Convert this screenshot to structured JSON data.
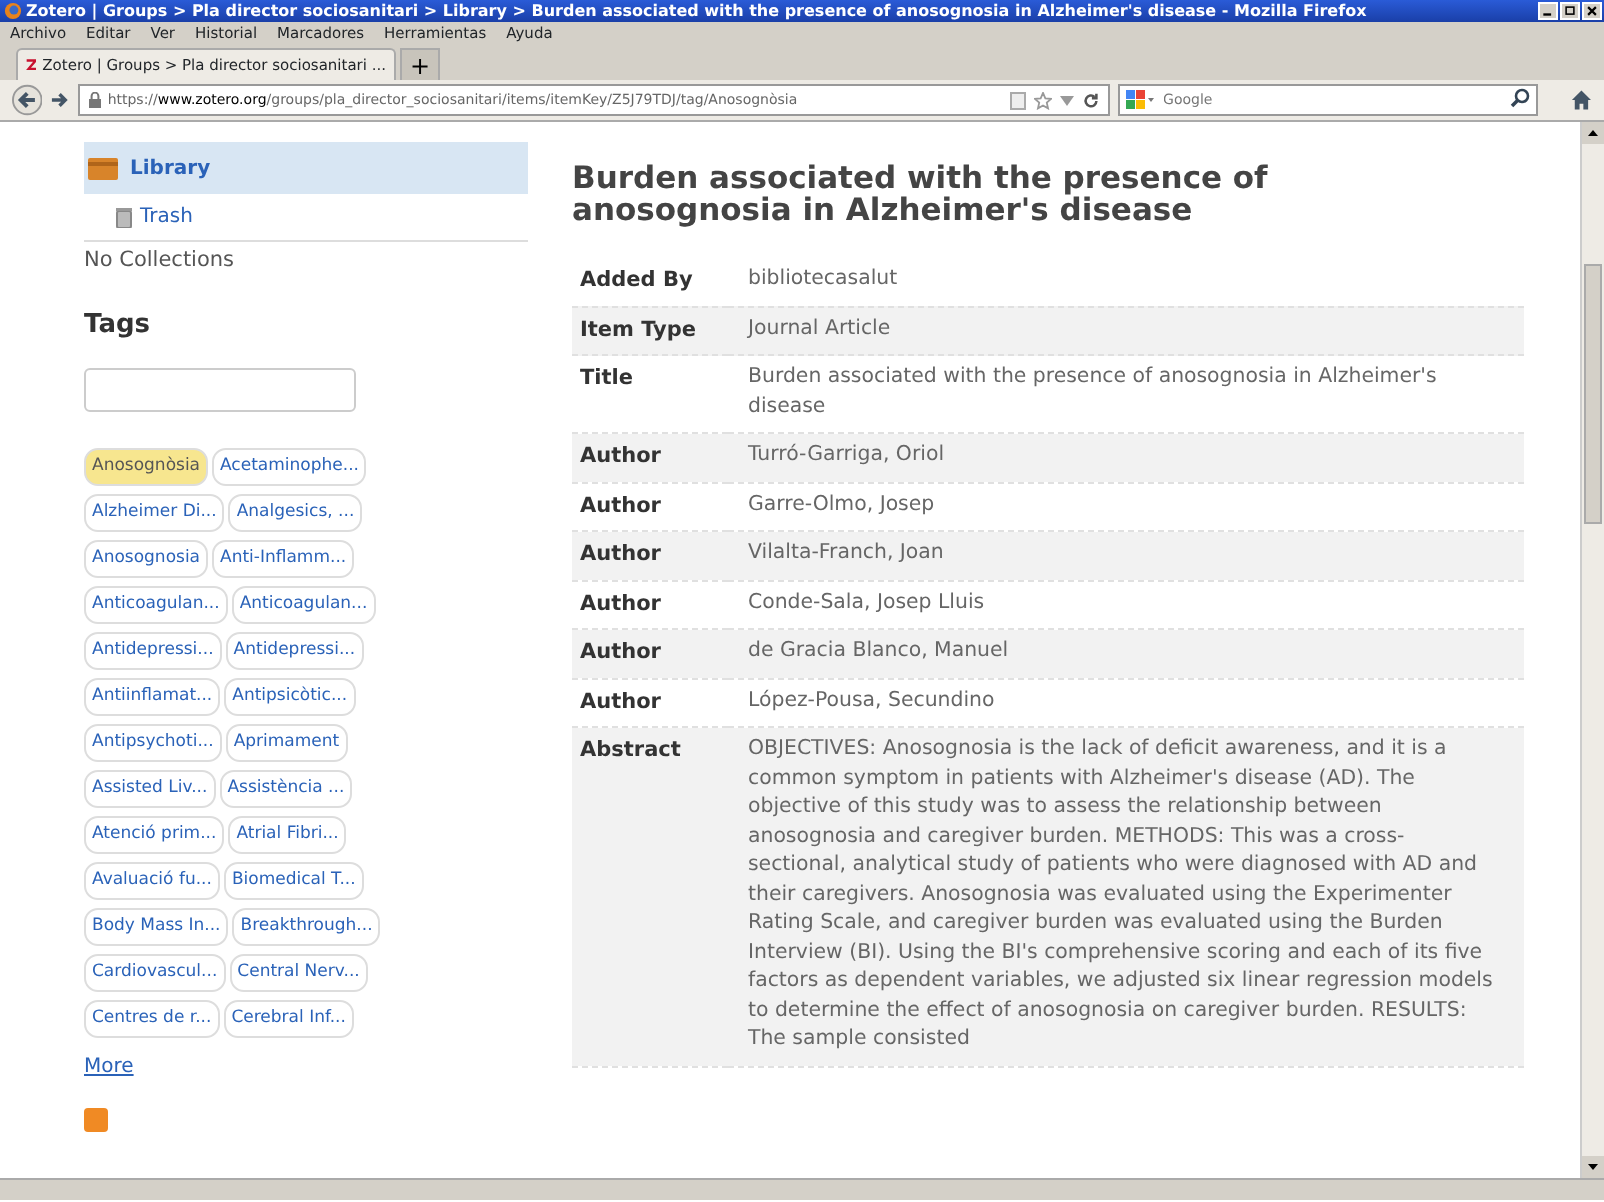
{
  "window": {
    "title": "Zotero | Groups > Pla director sociosanitari > Library > Burden associated with the presence of anosognosia in Alzheimer's disease - Mozilla Firefox"
  },
  "menu": [
    "Archivo",
    "Editar",
    "Ver",
    "Historial",
    "Marcadores",
    "Herramientas",
    "Ayuda"
  ],
  "tabs": [
    {
      "label": "Zotero | Groups > Pla director sociosanitari ...",
      "selected": true
    }
  ],
  "new_tab": "+",
  "address": "https://**www.zotero.org**/groups/pla_director_sociosanitari/items/itemKey/Z5J79TDJ/tag/Anosognòsia",
  "search": {
    "placeholder": "Google"
  },
  "sidebar": {
    "library": {
      "label": "Library",
      "selected": true
    },
    "trash": "Trash",
    "no_collections": "No Collections",
    "tags_heading": "Tags",
    "tags": [
      {
        "label": "Anosognòsia",
        "selected": true
      },
      {
        "label": "Acetaminophe...",
        "selected": false
      },
      {
        "label": "Alzheimer Di...",
        "selected": false
      },
      {
        "label": "Analgesics, ...",
        "selected": false
      },
      {
        "label": "Anosognosia",
        "selected": false
      },
      {
        "label": "Anti-Inflamm...",
        "selected": false
      },
      {
        "label": "Anticoagulan...",
        "selected": false
      },
      {
        "label": "Anticoagulan...",
        "selected": false
      },
      {
        "label": "Antidepressi...",
        "selected": false
      },
      {
        "label": "Antidepressi...",
        "selected": false
      },
      {
        "label": "Antiinflamat...",
        "selected": false
      },
      {
        "label": "Antipsicòtic...",
        "selected": false
      },
      {
        "label": "Antipsychoti...",
        "selected": false
      },
      {
        "label": "Aprimament",
        "selected": false
      },
      {
        "label": "Assisted Liv...",
        "selected": false
      },
      {
        "label": "Assistència ...",
        "selected": false
      },
      {
        "label": "Atenció prim...",
        "selected": false
      },
      {
        "label": "Atrial Fibri...",
        "selected": false
      },
      {
        "label": "Avaluació fu...",
        "selected": false
      },
      {
        "label": "Biomedical T...",
        "selected": false
      },
      {
        "label": "Body Mass In...",
        "selected": false
      },
      {
        "label": "Breakthrough...",
        "selected": false
      },
      {
        "label": "Cardiovascul...",
        "selected": false
      },
      {
        "label": "Central Nerv...",
        "selected": false
      },
      {
        "label": "Centres de r...",
        "selected": false
      },
      {
        "label": "Cerebral Inf...",
        "selected": false
      }
    ],
    "more": "More"
  },
  "item": {
    "title": "Burden associated with the presence of anosognosia in Alzheimer's disease",
    "fields": [
      {
        "label": "Added By",
        "value": "bibliotecasalut"
      },
      {
        "label": "Item Type",
        "value": "Journal Article"
      },
      {
        "label": "Title",
        "value": "Burden associated with the presence of anosognosia in Alzheimer's disease"
      },
      {
        "label": "Author",
        "value": "Turró-Garriga, Oriol"
      },
      {
        "label": "Author",
        "value": "Garre-Olmo, Josep"
      },
      {
        "label": "Author",
        "value": "Vilalta-Franch, Joan"
      },
      {
        "label": "Author",
        "value": "Conde-Sala, Josep Lluis"
      },
      {
        "label": "Author",
        "value": "de Gracia Blanco, Manuel"
      },
      {
        "label": "Author",
        "value": "López-Pousa, Secundino"
      },
      {
        "label": "Abstract",
        "value": "OBJECTIVES: Anosognosia is the lack of deficit awareness, and it is a common symptom in patients with Alzheimer's disease (AD). The objective of this study was to assess the relationship between anosognosia and caregiver burden. METHODS: This was a cross-sectional, analytical study of patients who were diagnosed with AD and their caregivers. Anosognosia was evaluated using the Experimenter Rating Scale, and caregiver burden was evaluated using the Burden Interview (BI). Using the BI's comprehensive scoring and each of its five factors as dependent variables, we adjusted six linear regression models to determine the effect of anosognosia on caregiver burden. RESULTS: The sample consisted"
      }
    ]
  }
}
